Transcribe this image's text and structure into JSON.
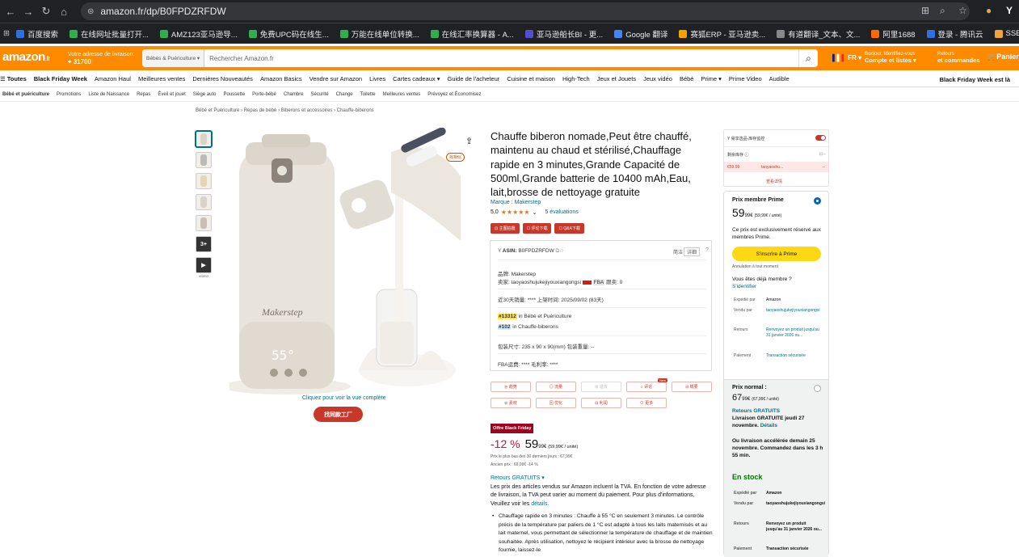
{
  "browser": {
    "url": "amazon.fr/dp/B0FPDZRFDW"
  },
  "bookmarks": [
    "百度搜索",
    "在线网址批量打开...",
    "AMZ123亚马逊导...",
    "免费UPC码在线生...",
    "万能在线单位转换...",
    "在线汇率换算器 - A...",
    "亚马逊船长BI - 更...",
    "Google 翻译",
    "赛狐ERP - 亚马逊卖...",
    "有道翻译_文本、文...",
    "阿里1688",
    "登录 - 腾讯云",
    "SSEU"
  ],
  "header": {
    "logo": "amazon",
    "logo_tld": ".fr",
    "deliver_line1": "Votre adresse de livraison:",
    "deliver_line2": "31700",
    "search_category": "Bébés & Puériculture ▾",
    "search_placeholder": "Rechercher Amazon.fr",
    "lang": "FR ▾",
    "account_line1": "Bonjour, Identifiez-vous",
    "account_line2": "Compte et listes ▾",
    "returns_line1": "Retours",
    "returns_line2": "et commandes",
    "cart": "Panier"
  },
  "nav_main": [
    "Toutes",
    "Black Friday Week",
    "Amazon Haul",
    "Meilleures ventes",
    "Dernières Nouveautés",
    "Amazon Basics",
    "Vendre sur Amazon",
    "Livres",
    "Cartes cadeaux ▾",
    "Guide de l'acheteur",
    "Cuisine et maison",
    "High-Tech",
    "Jeux et Jouets",
    "Jeux vidéo",
    "Bébé",
    "Prime ▾",
    "Prime Video",
    "Audible"
  ],
  "nav_promo": "Black Friday Week est là",
  "nav_sub": [
    "Bébé et puériculture",
    "Promotions",
    "Liste de Naissance",
    "Repas",
    "Éveil et jouet",
    "Siège auto",
    "Poussette",
    "Porte-bébé",
    "Chambre",
    "Sécurité",
    "Change",
    "Toilette",
    "Meilleures ventes",
    "Prévoyez et Économisez"
  ],
  "breadcrumb": "Bébé et Puériculture › Repas de bébé › Biberons et accessoires › Chauffe-biberons",
  "gallery": {
    "more_count": "3+",
    "video_label": "VIDEO",
    "zoom_link": "Cliquez pour voir la vue complète",
    "factory_btn": "找同款工厂",
    "magnifier": "找相似",
    "brand_on_bottle": "Makerstep",
    "display": "55°"
  },
  "product": {
    "title": "Chauffe biberon nomade,Peut être chauffé, maintenu au chaud et stérilisé,Chauffage rapide en 3 minutes,Grande Capacité de 500ml,Grande batterie de 10400 mAh,Eau, lait,brosse de nettoyage gratuite",
    "brand": "Marque : Makerstep",
    "rating": "5,0",
    "stars": "★★★★★",
    "reviews": "5 évaluations",
    "tool_buttons": [
      "⊡ 主图拍摄",
      "☐ 评论下载",
      "☐ Q&A下载"
    ]
  },
  "plugin": {
    "asin_label": "ASIN:",
    "asin": "B0FPDZRFDW",
    "mode1": "简洁",
    "mode2": "详细",
    "brand_line": "品牌:  Makerstep",
    "seller_line": "卖家:  taoyaoshujukejiyouxiangongsi",
    "fba": "FBA",
    "follow": "跟卖: 0",
    "sales_line": "近30天销量:  ****  上架时间:  2025/09/02",
    "days": "(83天)",
    "rank1_num": "#13312",
    "rank1_cat": "in Bébé et Puériculture",
    "rank2_num": "#102",
    "rank2_cat": "in Chauffe-biberons",
    "size_line": "包装尺寸:  235 x 90 x 90(mm)  包装重量:  --",
    "fee_line": "FBA运费:  ****  毛利率:  ****",
    "tabs": [
      "⊵ 趋势",
      "◎ 流量",
      "⊞ 退货",
      "⌕ 评论",
      "⊟ 概要",
      "⊏ 素材",
      "⊠ 优化",
      "⊟ 利润",
      "⊙ 更多"
    ],
    "new_badge": "New"
  },
  "pricing": {
    "badge": "Offre Black Friday",
    "discount": "-12 %",
    "price_int": "59",
    "price_dec": "99",
    "price_unit": "€",
    "unit_price": "(59,99€ / unité)",
    "low30": "Prix le plus bas des 30 derniers jours : 67,99€",
    "old": "Ancien prix : 69,99€ -14 %",
    "returns": "Retours GRATUITS ▾",
    "vat_text": "Les prix des articles vendus sur Amazon incluent la TVA. En fonction de votre adresse de livraison, la TVA peut varier au moment du paiement. Pour plus d'informations, Veuillez voir les ",
    "vat_link": "détails.",
    "bullet": "Chauffage rapide en 3 minutes : Chauffe à 55 °C en seulement 3 minutes. Le contrôle précis de la température par paliers de 1 °C est adapté à tous les laits maternisés et au lait maternel, vous permettant de sélectionner la température de chauffage et de maintien souhaitée. Après utilisation, nettoyez le récipient intérieur avec la brosse de nettoyage fournie, laissez-le"
  },
  "side_plugin": {
    "title": "Y 易享选品-库存监控",
    "stock_label": "剩余库存 ⓘ",
    "price": "€59.99",
    "seller": "taoyaoshu...",
    "dash": "--",
    "detail": "查看详情"
  },
  "buybox": {
    "prime_label": "Prix membre Prime",
    "prime_int": "59",
    "prime_dec": "99",
    "prime_unit": "(59,99€ / unité)",
    "prime_excl": "Ce prix est exclusivement réservé aux membres Prime.",
    "prime_btn": "S'inscrire à Prime",
    "cancel": "Annulation à tout moment",
    "member_q": "Vous êtes déjà membre ?",
    "signin": "S'identifier",
    "ship_k": "Expédié par",
    "ship_v": "Amazon",
    "sold_k": "Vendu par",
    "sold_v": "taoyaoshujukejiyouxiangongsi",
    "ret_k": "Retours",
    "ret_v": "Renvoyez un produit jusqu'au 31 janvier 2026 ou...",
    "pay_k": "Paiement",
    "pay_v": "Transaction sécurisée",
    "normal_label": "Prix normal :",
    "normal_int": "67",
    "normal_dec": "99",
    "normal_unit": "(67,99€ / unité)",
    "normal_ret": "Retours GRATUITS",
    "delivery": "Livraison GRATUITE jeudi 27 novembre.",
    "details": "Détails",
    "fast": "Ou livraison accélérée demain 25 novembre. Commandez dans les 3 h 55 min.",
    "instock": "En stock",
    "ship_v2": "Amazon",
    "sold_v2": "taoyaoshujukejiyouxiangongsi",
    "ret_v2": "Renvoyez un produit jusqu'au 31 janvier 2026 ou...",
    "pay_v2": "Transaction sécurisée"
  }
}
